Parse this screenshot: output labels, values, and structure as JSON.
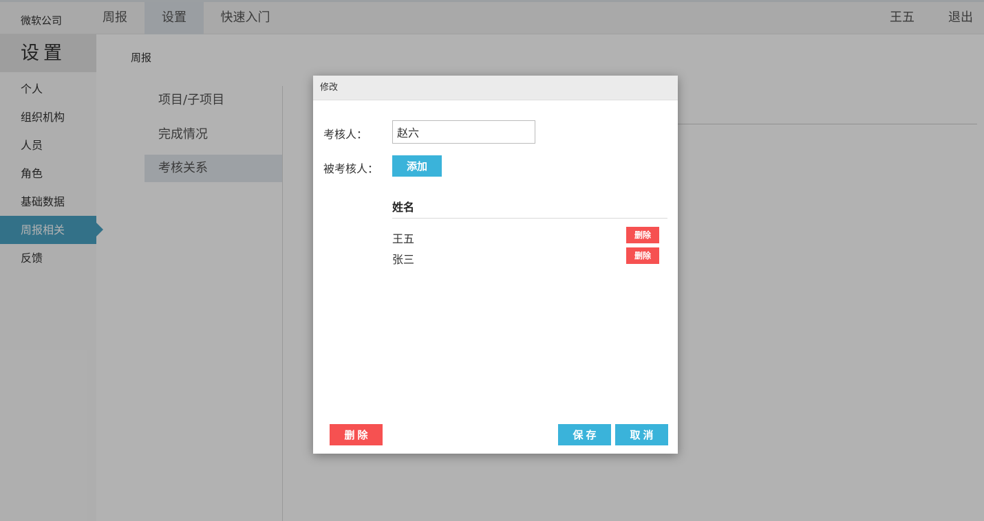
{
  "topbar": {
    "brand": "微软公司",
    "nav": [
      {
        "label": "周报"
      },
      {
        "label": "设置"
      },
      {
        "label": "快速入门"
      }
    ],
    "user": "王五",
    "logout": "退出"
  },
  "sidebar": {
    "title": "设置",
    "items": [
      {
        "label": "个人"
      },
      {
        "label": "组织机构"
      },
      {
        "label": "人员"
      },
      {
        "label": "角色"
      },
      {
        "label": "基础数据"
      },
      {
        "label": "周报相关"
      },
      {
        "label": "反馈"
      }
    ]
  },
  "main": {
    "breadcrumb": "周报",
    "subnav": [
      {
        "label": "项目/子项目"
      },
      {
        "label": "完成情况"
      },
      {
        "label": "考核关系"
      }
    ]
  },
  "modal": {
    "title": "修改",
    "reviewer_label": "考核人：",
    "reviewer_value": "赵六",
    "reviewee_label": "被考核人：",
    "add_label": "添加",
    "name_header": "姓名",
    "rows": [
      {
        "name": "王五",
        "delete": "删除"
      },
      {
        "name": "张三",
        "delete": "删除"
      }
    ],
    "delete_label": "删除",
    "save_label": "保存",
    "cancel_label": "取消"
  },
  "colors": {
    "accent_blue": "#3ab3da",
    "danger_red": "#f65151",
    "sidebar_active": "#4aa2c3"
  }
}
